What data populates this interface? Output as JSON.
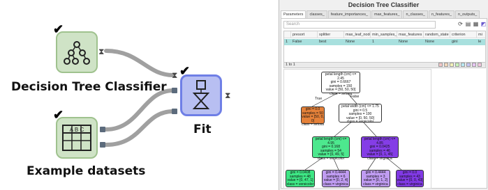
{
  "canvas": {
    "nodes": [
      {
        "id": "decision-tree",
        "label": "Decision Tree Classifier",
        "check": "✔",
        "port_out": "⧗"
      },
      {
        "id": "example-datasets",
        "label": "Example datasets",
        "check": "✔",
        "icon_text": "A B C"
      },
      {
        "id": "fit",
        "label": "Fit",
        "check": "✔",
        "port_in": "⧗",
        "port_out": "⧗"
      }
    ]
  },
  "window": {
    "title": "Decision Tree Classifier",
    "tabs": [
      "Parameters",
      "classes_",
      "feature_importances_",
      "max_features_",
      "n_classes_",
      "n_features_",
      "n_outputs_"
    ],
    "search_placeholder": "Search",
    "table": {
      "headers": [
        "presort",
        "splitter",
        "max_leaf_nodes",
        "min_samples_l",
        "max_features",
        "random_state",
        "criterion",
        "mi"
      ],
      "row_index": "1",
      "row": [
        "False",
        "best",
        "None",
        "1",
        "None",
        "None",
        "gini",
        "le"
      ]
    },
    "pager": "1 to 1",
    "toolbar_icons": [
      "refresh-icon",
      "document-icon",
      "table-icon",
      "image-icon"
    ]
  },
  "tree": {
    "edge_true": "True",
    "edge_false": "False",
    "nodes": [
      {
        "lines": [
          "petal length (cm) <= 2.45",
          "gini = 0.6667",
          "samples = 150",
          "value = [50, 50, 50]",
          "class = setosa"
        ],
        "color": "#ffffff"
      },
      {
        "lines": [
          "gini = 0.0",
          "samples = 50",
          "value = [50, 0, 0]",
          "class = setosa"
        ],
        "color": "#e58139"
      },
      {
        "lines": [
          "petal width (cm) <= 1.75",
          "gini = 0.5",
          "samples = 100",
          "value = [0, 50, 50]",
          "class = versicolor"
        ],
        "color": "#ffffff"
      },
      {
        "lines": [
          "petal length (cm) <= 4.95",
          "gini = 0.168",
          "samples = 54",
          "value = [0, 49, 5]",
          "class = versicolor"
        ],
        "color": "#4de88e"
      },
      {
        "lines": [
          "petal length (cm) <= 4.85",
          "gini = 0.0425",
          "samples = 46",
          "value = [0, 1, 45]",
          "class = virginica"
        ],
        "color": "#843de6"
      },
      {
        "lines": [
          "gini = 0.0408",
          "samples = 48",
          "value = [0, 47, 1]",
          "class = versicolor"
        ],
        "color": "#3de684"
      },
      {
        "lines": [
          "gini = 0.4444",
          "samples = 6",
          "value = [0, 2, 4]",
          "class = virginica"
        ],
        "color": "#c09cf2"
      },
      {
        "lines": [
          "gini = 0.4444",
          "samples = 3",
          "value = [0, 1, 2]",
          "class = virginica"
        ],
        "color": "#c09cf2"
      },
      {
        "lines": [
          "gini = 0.0",
          "samples = 43",
          "value = [0, 0, 43]",
          "class = virginica"
        ],
        "color": "#8139e5"
      }
    ]
  },
  "colors": {
    "node_green_bg": "#cfe3c6",
    "node_green_border": "#9fc28e",
    "node_blue_bg": "#b8bff2",
    "node_blue_border": "#6f7fe6",
    "link": "#a0a0a0",
    "table_row": "#a8e0de"
  }
}
